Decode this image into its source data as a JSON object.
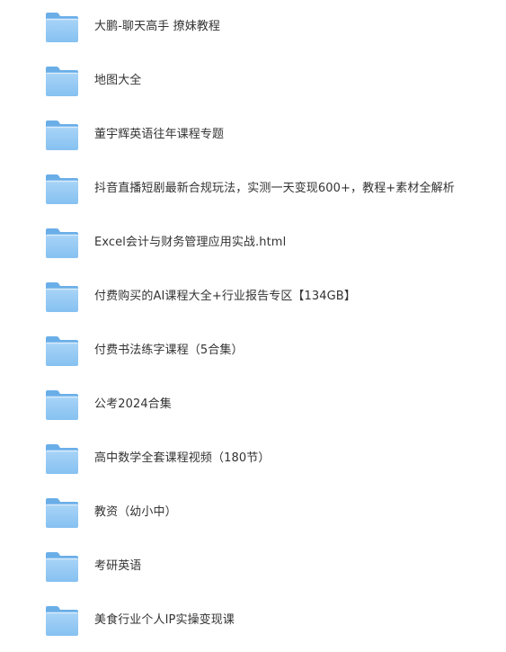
{
  "file_list": {
    "items": [
      {
        "name": "大鹏-聊天高手 撩妹教程",
        "icon": "folder-icon"
      },
      {
        "name": "地图大全",
        "icon": "folder-icon"
      },
      {
        "name": "董宇辉英语往年课程专题",
        "icon": "folder-icon"
      },
      {
        "name": "抖音直播短剧最新合规玩法，实测一天变现600+，教程+素材全解析",
        "icon": "folder-icon"
      },
      {
        "name": "Excel会计与财务管理应用实战.html",
        "icon": "folder-icon"
      },
      {
        "name": "付费购买的AI课程大全+行业报告专区【134GB】",
        "icon": "folder-icon"
      },
      {
        "name": "付费书法练字课程（5合集）",
        "icon": "folder-icon"
      },
      {
        "name": "公考2024合集",
        "icon": "folder-icon"
      },
      {
        "name": "高中数学全套课程视频（180节）",
        "icon": "folder-icon"
      },
      {
        "name": "教资（幼小中）",
        "icon": "folder-icon"
      },
      {
        "name": "考研英语",
        "icon": "folder-icon"
      },
      {
        "name": "美食行业个人IP实操变现课",
        "icon": "folder-icon"
      }
    ]
  },
  "colors": {
    "folder_light": "#a9d4f7",
    "folder_mid": "#86c1f1",
    "folder_dark": "#6aaee8",
    "text": "#333333",
    "background": "#ffffff"
  }
}
